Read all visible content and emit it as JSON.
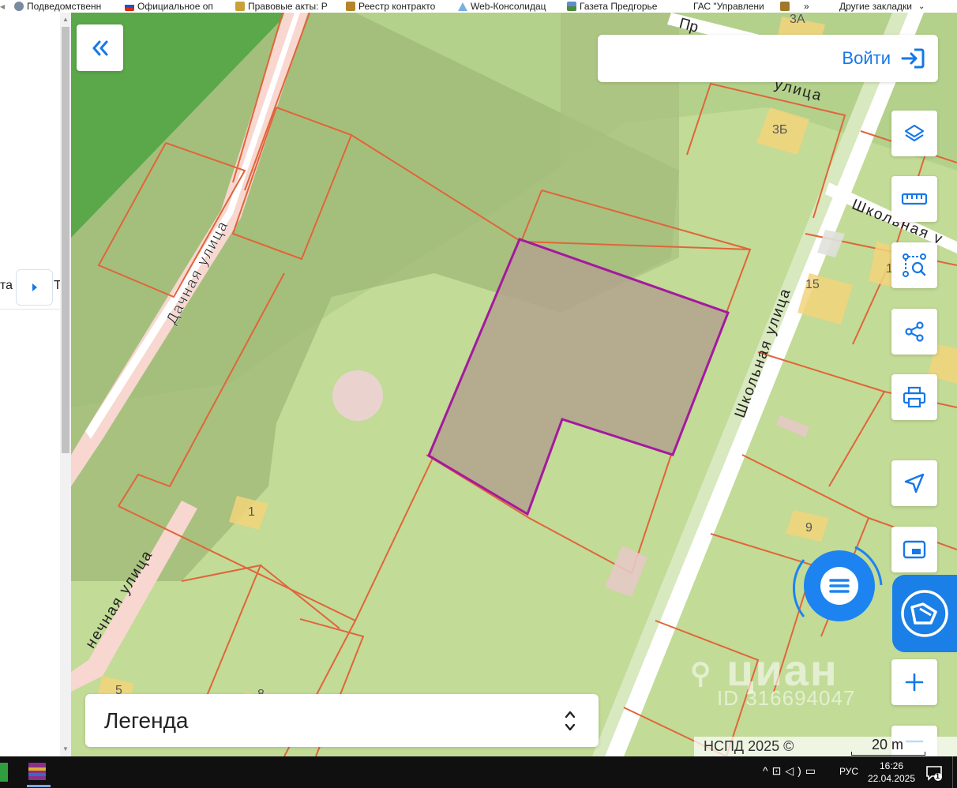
{
  "bookmarks": [
    {
      "label": "Подведомственн",
      "icon": "gear-icon"
    },
    {
      "label": "Официальное оп",
      "icon": "flag-icon"
    },
    {
      "label": "Правовые акты: Р",
      "icon": "emblem-icon"
    },
    {
      "label": "Реестр контракто",
      "icon": "emblem-icon"
    },
    {
      "label": "Web-Консолидац",
      "icon": "triangle-icon"
    },
    {
      "label": "Газета Предгорье",
      "icon": "landscape-icon"
    },
    {
      "label": "ГАС \"Управлени",
      "icon": "emblem-icon"
    },
    {
      "label": "»",
      "icon": ""
    },
    {
      "label": "Другие закладки",
      "icon": "chevron-down-icon"
    }
  ],
  "left_panel": {
    "partial_text": "та",
    "partial_text_right": "Т"
  },
  "map": {
    "login_label": "Войти",
    "legend_label": "Легенда",
    "attribution": "НСПД 2025 ©",
    "scale_label": "20 m",
    "watermark_brand": "циан",
    "watermark_id": "ID 316694047",
    "street_labels": [
      "Дачная улица",
      "Школьная улица",
      "Школьная у",
      "Пр",
      "улица",
      "нечная улица"
    ],
    "house_numbers": [
      "3А",
      "3Б",
      "15",
      "1",
      "9",
      "1",
      "5",
      "8"
    ],
    "colors": {
      "accent": "#1677e8",
      "parcel_border": "#e0653a",
      "selected_parcel": "#a4199f",
      "road": "#ffffff"
    }
  },
  "controls": [
    {
      "name": "layers-button",
      "icon": "layers-icon"
    },
    {
      "name": "measure-button",
      "icon": "ruler-icon"
    },
    {
      "name": "area-select-button",
      "icon": "area-search-icon"
    },
    {
      "name": "share-button",
      "icon": "share-icon"
    },
    {
      "name": "print-button",
      "icon": "printer-icon"
    },
    {
      "name": "geolocation-button",
      "icon": "navigation-arrow-icon"
    },
    {
      "name": "minimap-button",
      "icon": "picture-in-picture-icon"
    },
    {
      "name": "zoom-in-button",
      "icon": "plus-icon"
    },
    {
      "name": "zoom-out-button",
      "icon": "minus-icon"
    }
  ],
  "taskbar": {
    "lang": "РУС",
    "time": "16:26",
    "date": "22.04.2025",
    "notification_count": "1"
  }
}
